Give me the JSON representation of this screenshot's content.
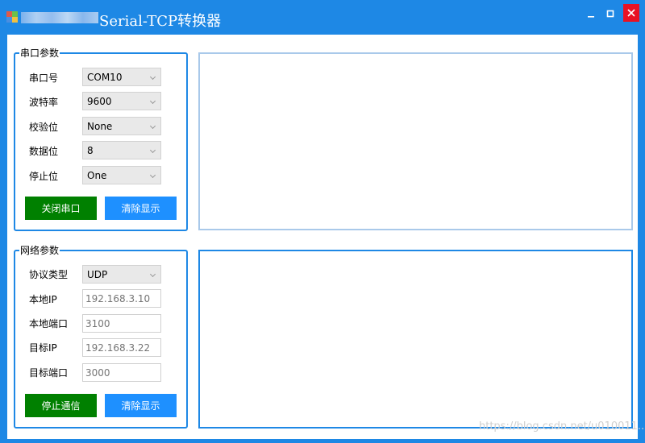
{
  "window": {
    "title": "Serial-TCP转换器",
    "colors": {
      "accent": "#1e88e5",
      "close": "#e81123",
      "green_button": "#008000",
      "blue_button": "#1e90ff"
    }
  },
  "serial": {
    "group_title": "串口参数",
    "fields": [
      {
        "label": "串口号",
        "value": "COM10"
      },
      {
        "label": "波特率",
        "value": "9600"
      },
      {
        "label": "校验位",
        "value": "None"
      },
      {
        "label": "数据位",
        "value": "8"
      },
      {
        "label": "停止位",
        "value": "One"
      }
    ],
    "close_button": "关闭串口",
    "clear_button": "清除显示"
  },
  "network": {
    "group_title": "网络参数",
    "protocol": {
      "label": "协议类型",
      "value": "UDP"
    },
    "local_ip": {
      "label": "本地IP",
      "placeholder": "192.168.3.10"
    },
    "local_port": {
      "label": "本地端口",
      "placeholder": "3100"
    },
    "target_ip": {
      "label": "目标IP",
      "placeholder": "192.168.3.22"
    },
    "target_port": {
      "label": "目标端口",
      "placeholder": "3000"
    },
    "stop_button": "停止通信",
    "clear_button": "清除显示"
  },
  "watermark": "https://blog.csdn.net/u010011..."
}
